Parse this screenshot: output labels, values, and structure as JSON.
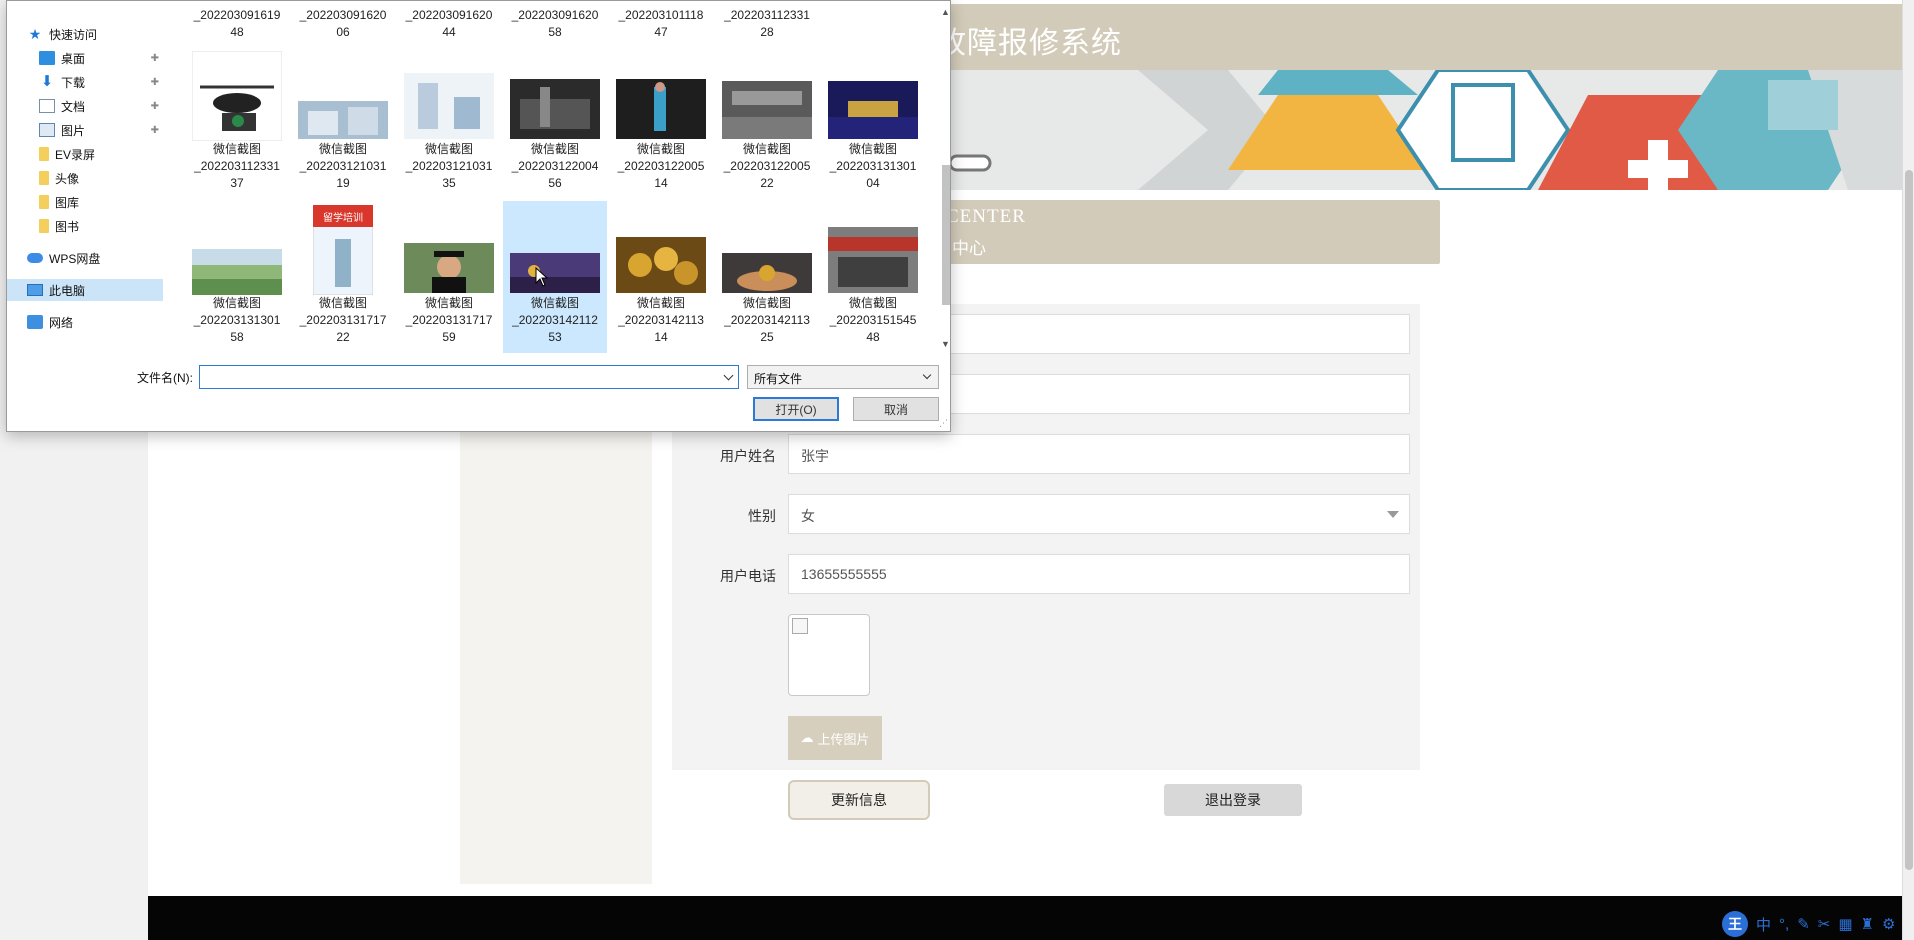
{
  "site": {
    "title_partial": "故障报修系统",
    "center_en": "CENTER",
    "center_cn": "中心"
  },
  "form": {
    "name_label": "用户姓名",
    "name_value": "张宇",
    "gender_label": "性别",
    "gender_value": "女",
    "phone_label": "用户电话",
    "phone_value": "13655555555",
    "upload_label": "上传图片",
    "update_button": "更新信息",
    "logout_button": "退出登录"
  },
  "ime": {
    "badge": "王",
    "mode": "中"
  },
  "dialog": {
    "nav": [
      {
        "label": "快速访问",
        "icon": "star-icon"
      },
      {
        "label": "桌面",
        "icon": "desktop-icon",
        "pinned": true
      },
      {
        "label": "下载",
        "icon": "download-icon",
        "pinned": true
      },
      {
        "label": "文档",
        "icon": "document-icon",
        "pinned": true
      },
      {
        "label": "图片",
        "icon": "pictures-icon",
        "pinned": true
      },
      {
        "label": "EV录屏",
        "icon": "folder-icon"
      },
      {
        "label": "头像",
        "icon": "folder-icon"
      },
      {
        "label": "图库",
        "icon": "folder-icon"
      },
      {
        "label": "图书",
        "icon": "folder-icon"
      },
      {
        "label": "WPS网盘",
        "icon": "cloud-icon"
      },
      {
        "label": "此电脑",
        "icon": "computer-icon",
        "selected": true
      },
      {
        "label": "网络",
        "icon": "network-icon"
      }
    ],
    "top_row": [
      [
        "_202203091619",
        "48"
      ],
      [
        "_202203091620",
        "06"
      ],
      [
        "_202203091620",
        "44"
      ],
      [
        "_202203091620",
        "58"
      ],
      [
        "_202203101118",
        "47"
      ],
      [
        "_202203112331",
        "28"
      ]
    ],
    "row1": [
      [
        "微信截图",
        "_202203112331",
        "37"
      ],
      [
        "微信截图",
        "_202203121031",
        "19"
      ],
      [
        "微信截图",
        "_202203121031",
        "35"
      ],
      [
        "微信截图",
        "_202203122004",
        "56"
      ],
      [
        "微信截图",
        "_202203122005",
        "14"
      ],
      [
        "微信截图",
        "_202203122005",
        "22"
      ],
      [
        "微信截图",
        "_202203131301",
        "04"
      ]
    ],
    "row2": [
      [
        "微信截图",
        "_202203131301",
        "58"
      ],
      [
        "微信截图",
        "_202203131717",
        "22"
      ],
      [
        "微信截图",
        "_202203131717",
        "59"
      ],
      [
        "微信截图",
        "_202203142112",
        "53"
      ],
      [
        "微信截图",
        "_202203142113",
        "14"
      ],
      [
        "微信截图",
        "_202203142113",
        "25"
      ],
      [
        "微信截图",
        "_202203151545",
        "48"
      ]
    ],
    "thumb_text": "留学培训",
    "filename_label": "文件名(N):",
    "filename_value": "",
    "filetype_value": "所有文件",
    "open_button": "打开(O)",
    "cancel_button": "取消"
  }
}
